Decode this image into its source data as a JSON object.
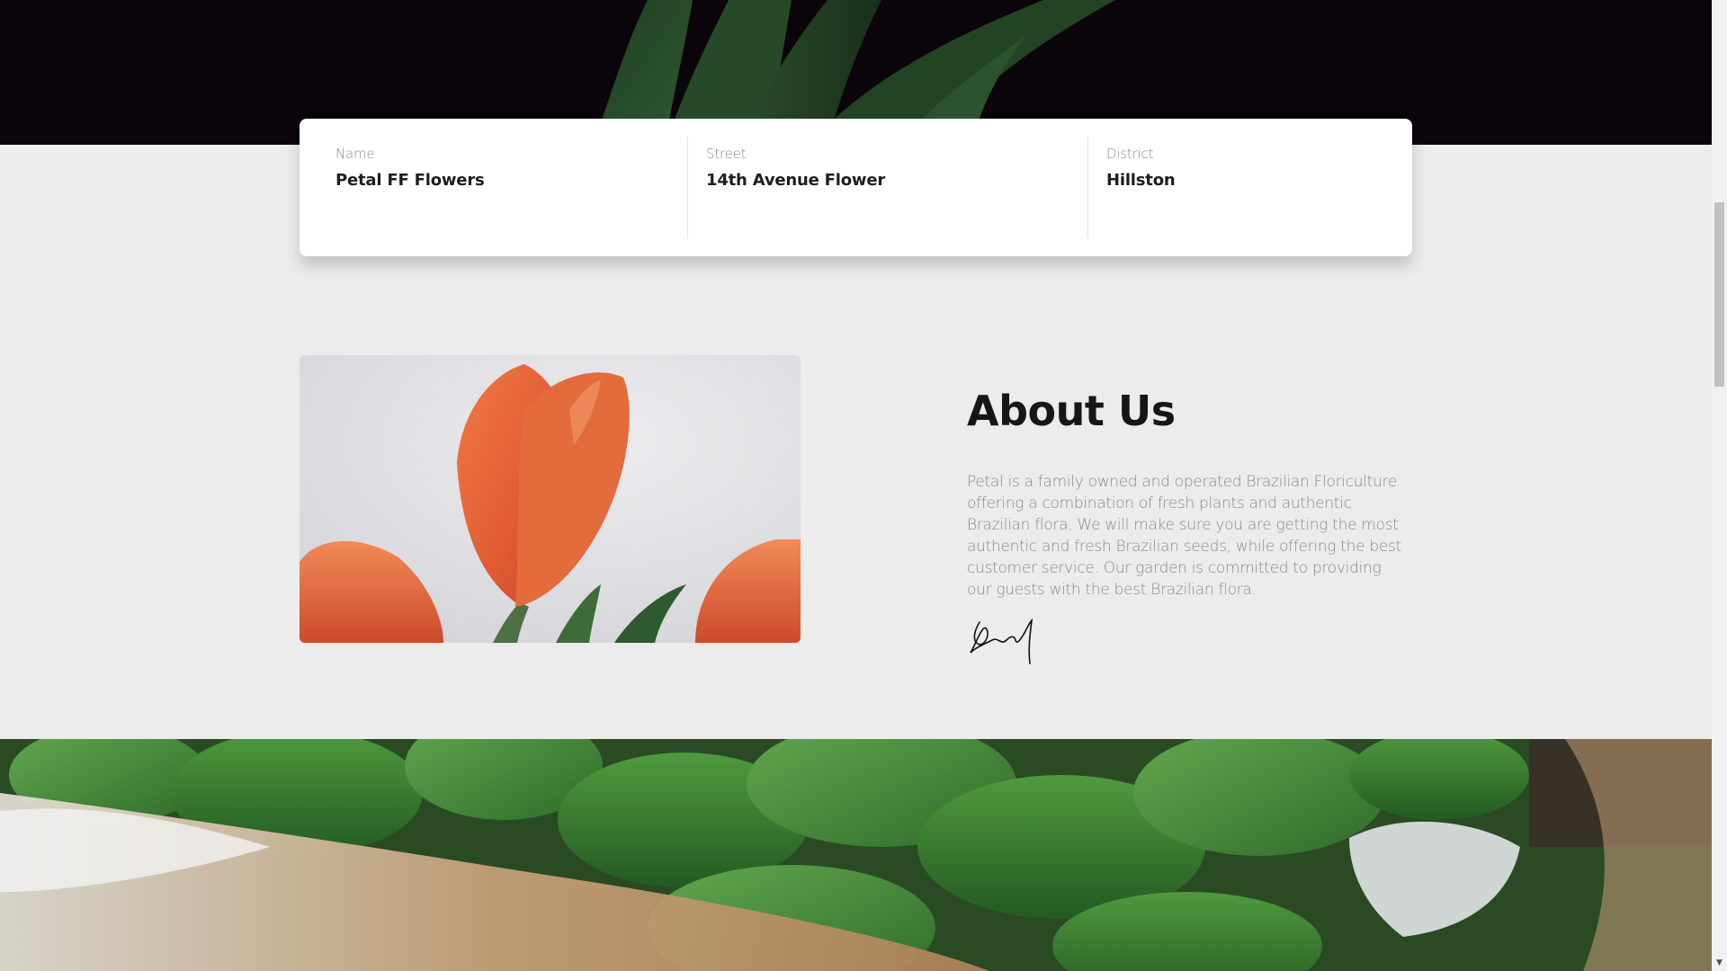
{
  "info_card": {
    "name_label": "Name",
    "name_value": "Petal FF Flowers",
    "street_label": "Street",
    "street_value": "14th Avenue Flower",
    "district_label": "District",
    "district_value": "Hillston"
  },
  "about": {
    "title": "About Us",
    "body": "Petal is a family owned and operated Brazilian Floriculture offering a combination of fresh plants and authentic Brazilian flora. We will make sure you are getting the most authentic and fresh Brazilian seeds, while offering the best customer service. Our garden is committed to providing our guests with the best Brazilian flora."
  },
  "scrollbar": {
    "down_arrow": "▼"
  },
  "colors": {
    "page_background": "#ececec",
    "hero_background": "#0b050b",
    "tulip_orange": "#e5653a",
    "leaf_green": "#3f7a33"
  }
}
